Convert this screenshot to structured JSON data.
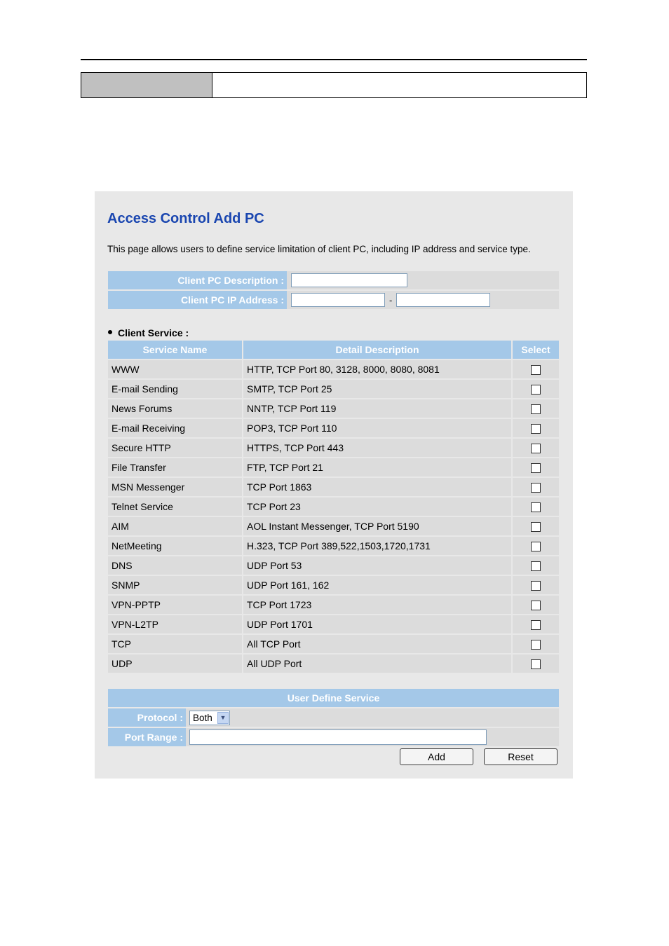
{
  "page": {
    "title": "Access Control Add PC",
    "description": "This page allows users to define service limitation of client PC, including IP address and service type."
  },
  "client_form": {
    "description_label": "Client PC Description :",
    "description_value": "",
    "ip_label": "Client PC IP Address :",
    "ip_start_value": "",
    "ip_end_value": "",
    "ip_separator": "-"
  },
  "client_service": {
    "section_label": "Client Service :",
    "columns": [
      "Service Name",
      "Detail Description",
      "Select"
    ],
    "rows": [
      {
        "name": "WWW",
        "detail": "HTTP, TCP Port 80, 3128, 8000, 8080, 8081",
        "selected": false
      },
      {
        "name": "E-mail Sending",
        "detail": "SMTP, TCP Port 25",
        "selected": false
      },
      {
        "name": "News Forums",
        "detail": "NNTP, TCP Port 119",
        "selected": false
      },
      {
        "name": "E-mail Receiving",
        "detail": "POP3, TCP Port 110",
        "selected": false
      },
      {
        "name": "Secure HTTP",
        "detail": "HTTPS, TCP Port 443",
        "selected": false
      },
      {
        "name": "File Transfer",
        "detail": "FTP, TCP Port 21",
        "selected": false
      },
      {
        "name": "MSN Messenger",
        "detail": "TCP Port 1863",
        "selected": false
      },
      {
        "name": "Telnet Service",
        "detail": "TCP Port 23",
        "selected": false
      },
      {
        "name": "AIM",
        "detail": "AOL Instant Messenger, TCP Port 5190",
        "selected": false
      },
      {
        "name": "NetMeeting",
        "detail": "H.323, TCP Port 389,522,1503,1720,1731",
        "selected": false
      },
      {
        "name": "DNS",
        "detail": "UDP Port 53",
        "selected": false
      },
      {
        "name": "SNMP",
        "detail": "UDP Port 161, 162",
        "selected": false
      },
      {
        "name": "VPN-PPTP",
        "detail": "TCP Port 1723",
        "selected": false
      },
      {
        "name": "VPN-L2TP",
        "detail": "UDP Port 1701",
        "selected": false
      },
      {
        "name": "TCP",
        "detail": "All TCP Port",
        "selected": false
      },
      {
        "name": "UDP",
        "detail": "All UDP Port",
        "selected": false
      }
    ]
  },
  "user_define": {
    "header": "User Define Service",
    "protocol_label": "Protocol :",
    "protocol_value": "Both",
    "port_range_label": "Port Range :",
    "port_range_value": ""
  },
  "buttons": {
    "add": "Add",
    "reset": "Reset"
  },
  "colors": {
    "title": "#1a46b0",
    "header_bg": "#a4c8e8",
    "row_bg": "#dcdcdc",
    "panel_bg": "#e8e8e8"
  }
}
